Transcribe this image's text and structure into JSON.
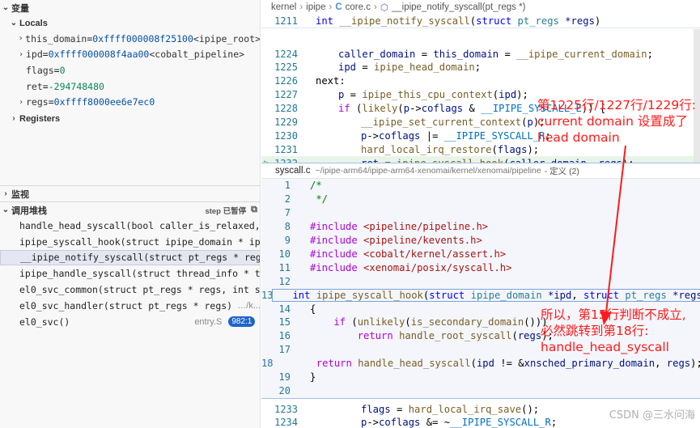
{
  "variables": {
    "title": "变量",
    "locals_label": "Locals",
    "locals": [
      {
        "name": "this_domain",
        "value": "0xffff000008f25100",
        "type": "<ipipe_root>",
        "expandable": true
      },
      {
        "name": "ipd",
        "value": "0xffff000008f4aa00",
        "type": "<cobalt_pipeline>",
        "expandable": true
      },
      {
        "name": "flags",
        "value": "0",
        "type": "",
        "expandable": false
      },
      {
        "name": "ret",
        "value": "-294748480",
        "type": "",
        "expandable": false
      },
      {
        "name": "regs",
        "value": "0xffff8000ee6e7ec0",
        "type": "",
        "expandable": true
      }
    ],
    "registers_label": "Registers"
  },
  "watch": {
    "title": "监视"
  },
  "callstack": {
    "title": "调用堆栈",
    "status": "step 已暂停",
    "frames": [
      {
        "text": "handle_head_syscall(bool caller_is_relaxed, str",
        "file": "",
        "badge": ""
      },
      {
        "text": "ipipe_syscall_hook(struct ipipe_domain * ipd, s",
        "file": "",
        "badge": ""
      },
      {
        "text": "__ipipe_notify_syscall(struct pt_regs * regs)",
        "file": "",
        "badge": ""
      },
      {
        "text": "ipipe_handle_syscall(struct thread_info * ti, u",
        "file": "",
        "badge": ""
      },
      {
        "text": "el0_svc_common(struct pt_regs * regs, int scno,",
        "file": "",
        "badge": ""
      },
      {
        "text": "el0_svc_handler(struct pt_regs * regs)",
        "file": "…/k...",
        "badge": ""
      },
      {
        "text": "el0_svc()",
        "file": "entry.S",
        "badge": "982:1"
      }
    ],
    "selected_index": 2
  },
  "editor": {
    "breadcrumb": [
      "kernel",
      "ipipe",
      "core.c",
      "__ipipe_notify_syscall(pt_regs *)"
    ],
    "sticky": {
      "num": "1211",
      "segments": [
        [
          "kw",
          "int "
        ],
        [
          "fn",
          "__ipipe_notify_syscall"
        ],
        [
          "",
          "("
        ],
        [
          "kw",
          "struct "
        ],
        [
          "ty",
          "pt_regs "
        ],
        [
          "var",
          "*regs"
        ],
        [
          "",
          ")"
        ]
      ]
    },
    "lines": [
      {
        "num": "1224",
        "segments": [
          [
            "var",
            "caller_domain"
          ],
          [
            "",
            " = "
          ],
          [
            "var",
            "this_domain"
          ],
          [
            "",
            " = "
          ],
          [
            "fn",
            "__ipipe_current_domain"
          ],
          [
            "",
            ";"
          ]
        ]
      },
      {
        "num": "1225",
        "segments": [
          [
            "var",
            "ipd"
          ],
          [
            "",
            " = "
          ],
          [
            "fn",
            "ipipe_head_domain"
          ],
          [
            "",
            ";"
          ]
        ]
      },
      {
        "num": "1226",
        "segments": [
          [
            "",
            "next:"
          ]
        ],
        "indent": 0
      },
      {
        "num": "1227",
        "segments": [
          [
            "var",
            "p"
          ],
          [
            "",
            " = "
          ],
          [
            "fn",
            "ipipe_this_cpu_context"
          ],
          [
            "",
            "("
          ],
          [
            "var",
            "ipd"
          ],
          [
            "",
            ");"
          ]
        ]
      },
      {
        "num": "1228",
        "segments": [
          [
            "kw2",
            "if "
          ],
          [
            "",
            "("
          ],
          [
            "fn",
            "likely"
          ],
          [
            "",
            "("
          ],
          [
            "var",
            "p"
          ],
          [
            "",
            "->"
          ],
          [
            "var",
            "coflags"
          ],
          [
            "",
            " & "
          ],
          [
            "mac",
            "__IPIPE_SYSCALL_E"
          ],
          [
            "",
            ")) {"
          ]
        ]
      },
      {
        "num": "1229",
        "segments": [
          [
            "fn",
            "__ipipe_set_current_context"
          ],
          [
            "",
            "("
          ],
          [
            "var",
            "p"
          ],
          [
            "",
            ");"
          ]
        ]
      },
      {
        "num": "1230",
        "segments": [
          [
            "var",
            "p"
          ],
          [
            "",
            "->"
          ],
          [
            "var",
            "coflags"
          ],
          [
            "",
            " |= "
          ],
          [
            "mac",
            "__IPIPE_SYSCALL_R"
          ],
          [
            "",
            ";"
          ]
        ]
      },
      {
        "num": "1231",
        "segments": [
          [
            "fn",
            "hard_local_irq_restore"
          ],
          [
            "",
            "("
          ],
          [
            "var",
            "flags"
          ],
          [
            "",
            ");"
          ]
        ]
      },
      {
        "num": "1232",
        "segments": [
          [
            "var",
            "ret"
          ],
          [
            "",
            " = "
          ],
          [
            "fn",
            "ipipe_syscall_hook"
          ],
          [
            "",
            "("
          ],
          [
            "var",
            "caller_domain"
          ],
          [
            "",
            ", "
          ],
          [
            "var",
            "regs"
          ],
          [
            "",
            ");"
          ]
        ]
      }
    ],
    "peek_header": {
      "file": "syscall.c",
      "path": "~/ipipe-arm64/ipipe-arm64-xenomai/kernel/xenomai/pipeline",
      "label": "- 定义 (2)"
    },
    "peek_lines": [
      {
        "num": "1",
        "segments": [
          [
            "cm",
            "/*"
          ]
        ]
      },
      {
        "num": "2",
        "segments": [
          [
            "cm",
            " */"
          ]
        ]
      },
      {
        "num": "7",
        "segments": []
      },
      {
        "num": "8",
        "segments": [
          [
            "pp",
            "#include "
          ],
          [
            "str",
            "<pipeline/pipeline.h>"
          ]
        ]
      },
      {
        "num": "9",
        "segments": [
          [
            "pp",
            "#include "
          ],
          [
            "str",
            "<pipeline/kevents.h>"
          ]
        ]
      },
      {
        "num": "10",
        "segments": [
          [
            "pp",
            "#include "
          ],
          [
            "str",
            "<cobalt/kernel/assert.h>"
          ]
        ]
      },
      {
        "num": "11",
        "segments": [
          [
            "pp",
            "#include "
          ],
          [
            "str",
            "<xenomai/posix/syscall.h>"
          ]
        ]
      },
      {
        "num": "12",
        "segments": []
      },
      {
        "num": "13",
        "segments": [
          [
            "kw",
            "int "
          ],
          [
            "fn",
            "ipipe_syscall_hook"
          ],
          [
            "",
            "("
          ],
          [
            "kw",
            "struct "
          ],
          [
            "ty",
            "ipipe_domain "
          ],
          [
            "var",
            "*ipd"
          ],
          [
            "",
            ", "
          ],
          [
            "kw",
            "struct "
          ],
          [
            "ty",
            "pt_regs "
          ],
          [
            "var",
            "*regs"
          ],
          [
            "",
            ")"
          ]
        ]
      },
      {
        "num": "14",
        "segments": [
          [
            "",
            "{"
          ]
        ]
      },
      {
        "num": "15",
        "segments": [
          [
            "kw2",
            "    if "
          ],
          [
            "",
            "("
          ],
          [
            "fn",
            "unlikely"
          ],
          [
            "",
            "("
          ],
          [
            "fn",
            "is_secondary_domain"
          ],
          [
            "",
            "()))"
          ]
        ]
      },
      {
        "num": "16",
        "segments": [
          [
            "kw2",
            "        return "
          ],
          [
            "fn",
            "handle_root_syscall"
          ],
          [
            "",
            "("
          ],
          [
            "var",
            "regs"
          ],
          [
            "",
            ");"
          ]
        ]
      },
      {
        "num": "17",
        "segments": []
      },
      {
        "num": "18",
        "segments": [
          [
            "kw2",
            "    return "
          ],
          [
            "fn",
            "handle_head_syscall"
          ],
          [
            "",
            "("
          ],
          [
            "var",
            "ipd"
          ],
          [
            "",
            " != &"
          ],
          [
            "var",
            "xnsched_primary_domain"
          ],
          [
            "",
            ", "
          ],
          [
            "var",
            "regs"
          ],
          [
            "",
            ");"
          ]
        ]
      },
      {
        "num": "19",
        "segments": [
          [
            "",
            "}"
          ]
        ]
      },
      {
        "num": "20",
        "segments": []
      }
    ],
    "after_lines": [
      {
        "num": "1233",
        "segments": [
          [
            "var",
            "flags"
          ],
          [
            "",
            " = "
          ],
          [
            "fn",
            "hard_local_irq_save"
          ],
          [
            "",
            "();"
          ]
        ]
      },
      {
        "num": "1234",
        "segments": [
          [
            "var",
            "p"
          ],
          [
            "",
            "->"
          ],
          [
            "var",
            "coflags"
          ],
          [
            "",
            " &= ~"
          ],
          [
            "mac",
            "__IPIPE_SYSCALL_R"
          ],
          [
            "",
            ";"
          ]
        ]
      }
    ]
  },
  "annotations": {
    "top": [
      "第1225行/1227行/1229行:",
      "current domain 设置成了",
      "head domain"
    ],
    "bottom": [
      "所以，第15行判断不成立,",
      "必然跳转到第18行:",
      "handle_head_syscall"
    ]
  },
  "watermark": "CSDN @三水问海",
  "colors": {
    "annotation": "#ff1a1a",
    "arrow": "#ff1a1a",
    "badge": "#1e64c8"
  }
}
